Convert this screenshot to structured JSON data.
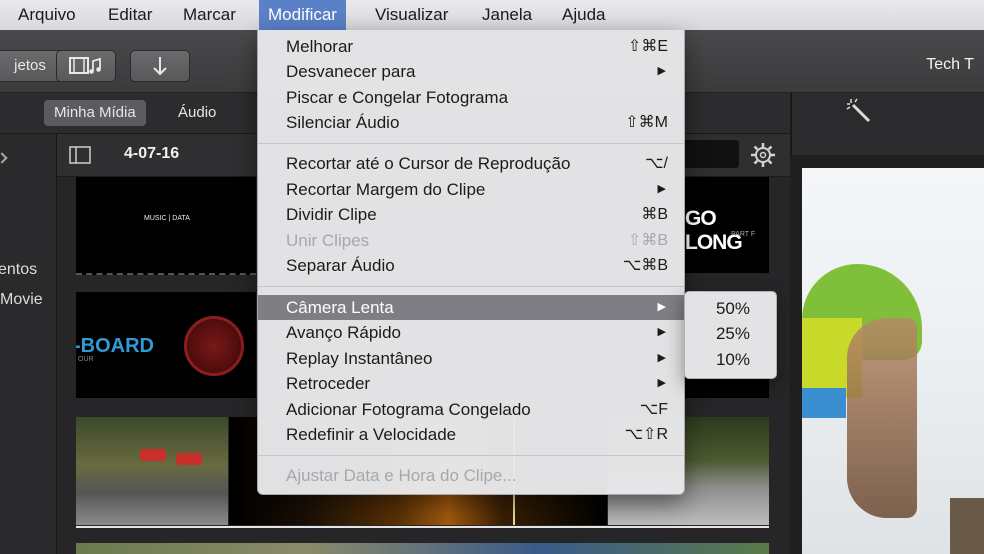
{
  "menubar": {
    "items": [
      "Arquivo",
      "Editar",
      "Marcar",
      "Modificar",
      "Visualizar",
      "Janela",
      "Ajuda"
    ],
    "active": "Modificar"
  },
  "toolbar": {
    "projects_label": "jetos",
    "title": "Tech T"
  },
  "browser": {
    "tabs": [
      "Minha Mídia",
      "Áudio"
    ],
    "selected_tab": "Minha Mídia",
    "event_date": "4-07-16"
  },
  "sidebar": {
    "items": [
      "entos",
      "Movie"
    ]
  },
  "clips": {
    "clip1_text": "MUSIC | DATA",
    "clip2_text": "GO LONG",
    "clip2_sub": "PART F",
    "clip3_text": "-BOARD",
    "clip3_sub": "OUR"
  },
  "menu": {
    "groups": [
      [
        {
          "label": "Melhorar",
          "shortcut": "⇧⌘E"
        },
        {
          "label": "Desvanecer para",
          "submenu": true
        },
        {
          "label": "Piscar e Congelar Fotograma"
        },
        {
          "label": "Silenciar Áudio",
          "shortcut": "⇧⌘M"
        }
      ],
      [
        {
          "label": "Recortar até o Cursor de Reprodução",
          "shortcut": "⌥/"
        },
        {
          "label": "Recortar Margem do Clipe",
          "submenu": true
        },
        {
          "label": "Dividir Clipe",
          "shortcut": "⌘B"
        },
        {
          "label": "Unir Clipes",
          "shortcut": "⇧⌘B",
          "disabled": true
        },
        {
          "label": "Separar Áudio",
          "shortcut": "⌥⌘B"
        }
      ],
      [
        {
          "label": "Câmera Lenta",
          "submenu": true,
          "highlighted": true
        },
        {
          "label": "Avanço Rápido",
          "submenu": true
        },
        {
          "label": "Replay Instantâneo",
          "submenu": true
        },
        {
          "label": "Retroceder",
          "submenu": true
        },
        {
          "label": "Adicionar Fotograma Congelado",
          "shortcut": "⌥F"
        },
        {
          "label": "Redefinir a Velocidade",
          "shortcut": "⌥⇧R"
        }
      ],
      [
        {
          "label": "Ajustar Data e Hora do Clipe...",
          "disabled": true
        }
      ]
    ]
  },
  "submenu": {
    "items": [
      "50%",
      "25%",
      "10%"
    ]
  },
  "colors": {
    "menubar_active": "#5a80c8",
    "menu_highlight": "#7e7e84",
    "accent_blue": "#2e9bd6"
  }
}
